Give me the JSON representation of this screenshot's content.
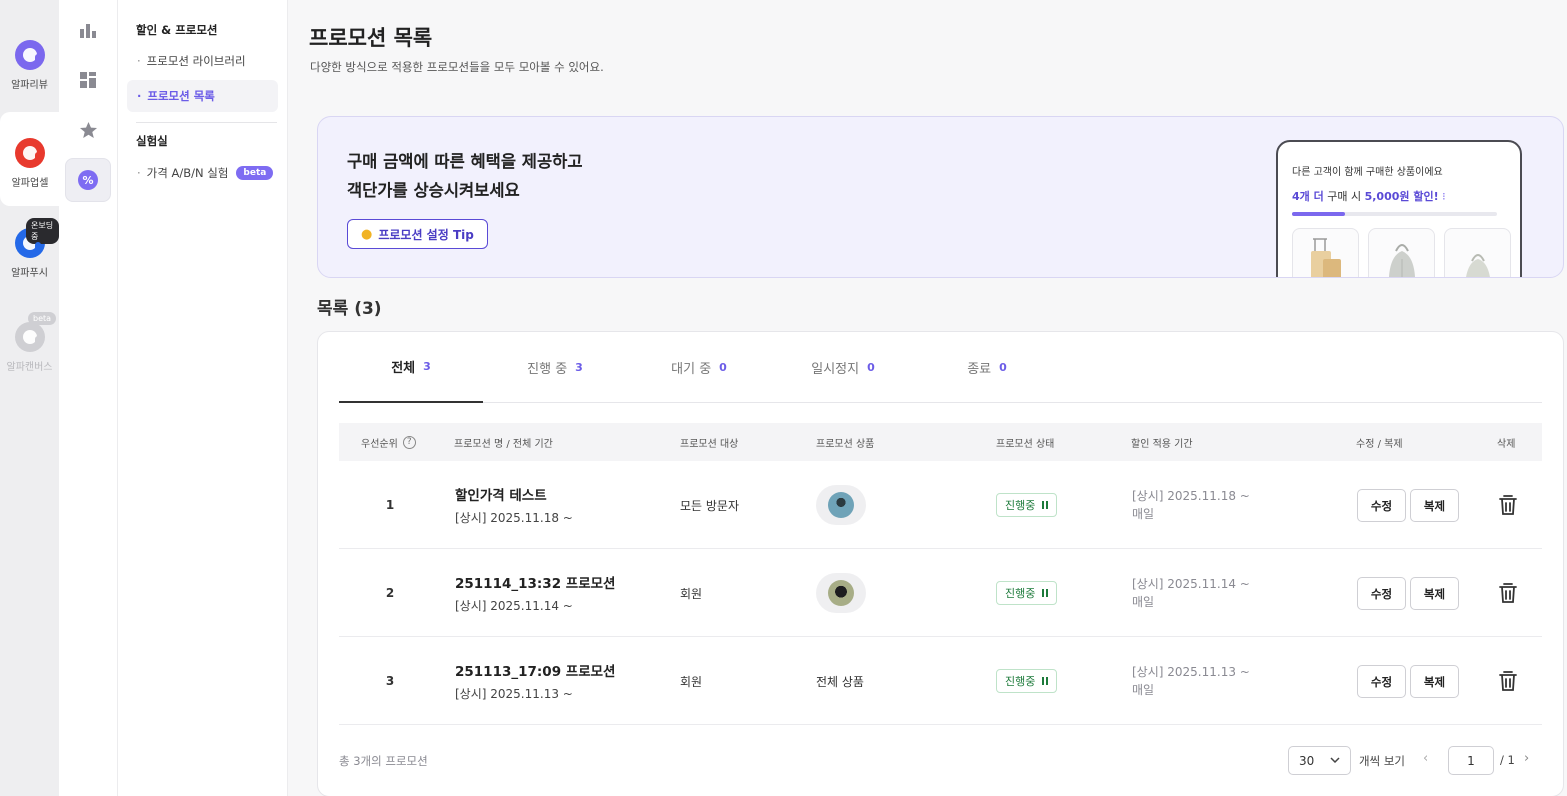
{
  "apps": [
    {
      "name": "알파리뷰",
      "color": "#7b68ee",
      "badge": ""
    },
    {
      "name": "알파업셀",
      "color": "#e8392d",
      "badge": ""
    },
    {
      "name": "알파푸시",
      "color": "#2469e8",
      "badge": "온보딩중"
    },
    {
      "name": "알파캔버스",
      "color": "#cfcfd3",
      "badge": "beta"
    }
  ],
  "icon_rail": [
    "bar-chart-icon",
    "dashboard-icon",
    "star-icon",
    "percent-icon"
  ],
  "subnav": {
    "section1": "할인 & 프로모션",
    "items1": [
      "프로모션 라이브러리",
      "프로모션 목록"
    ],
    "section2": "실험실",
    "items2": [
      {
        "label": "가격 A/B/N 실험",
        "badge": "beta"
      }
    ]
  },
  "page": {
    "title": "프로모션 목록",
    "desc": "다양한 방식으로 적용한 프로모션들을 모두 모아볼 수 있어요."
  },
  "banner": {
    "line1": "구매 금액에 따른 혜택을 제공하고",
    "line2": "객단가를 상승시켜보세요",
    "tip_button": "프로모션 설정 Tip",
    "mock_title": "다른 고객이 함께 구매한 상품이에요",
    "mock_count": "4개 더",
    "mock_mid": "구매 시",
    "mock_discount": "5,000원 할인!",
    "mock_progress": 0.26
  },
  "list": {
    "title": "목록 (3)",
    "tabs": [
      {
        "label": "전체",
        "count": "3"
      },
      {
        "label": "진행 중",
        "count": "3"
      },
      {
        "label": "대기 중",
        "count": "0"
      },
      {
        "label": "일시정지",
        "count": "0"
      },
      {
        "label": "종료",
        "count": "0"
      }
    ],
    "headers": {
      "priority": "우선순위",
      "name": "프로모션 명 / 전체 기간",
      "target": "프로모션 대상",
      "product": "프로모션 상품",
      "status": "프로모션 상태",
      "period": "할인 적용 기간",
      "edit": "수정 / 복제",
      "delete": "삭제"
    },
    "rows": [
      {
        "rank": "1",
        "name": "할인가격 테스트",
        "term": "[상시] 2025.11.18 ~",
        "target": "모든 방문자",
        "product": "",
        "status": "진행중",
        "period1": "[상시] 2025.11.18 ~",
        "period2": "매일",
        "edit": "수정",
        "copy": "복제"
      },
      {
        "rank": "2",
        "name": "251114_13:32 프로모션",
        "term": "[상시] 2025.11.14 ~",
        "target": "회원",
        "product": "",
        "status": "진행중",
        "period1": "[상시] 2025.11.14 ~",
        "period2": "매일",
        "edit": "수정",
        "copy": "복제"
      },
      {
        "rank": "3",
        "name": "251113_17:09 프로모션",
        "term": "[상시] 2025.11.13 ~",
        "target": "회원",
        "product": "전체 상품",
        "status": "진행중",
        "period1": "[상시] 2025.11.13 ~",
        "period2": "매일",
        "edit": "수정",
        "copy": "복제"
      }
    ],
    "footer": {
      "total": "총 3개의 프로모션",
      "per_page": "30",
      "per_label": "개씩 보기",
      "page": "1",
      "page_total": "/ 1"
    }
  }
}
